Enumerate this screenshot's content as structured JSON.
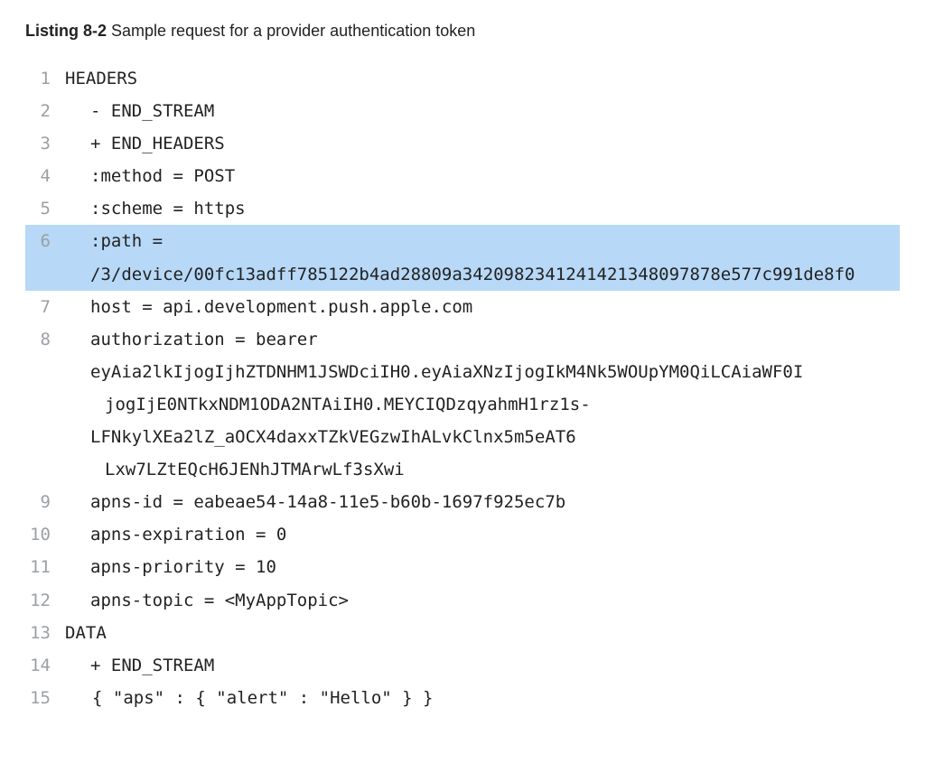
{
  "caption": {
    "label": "Listing 8-2",
    "title": "Sample request for a provider authentication token"
  },
  "lines": {
    "l1": {
      "num": "1",
      "text": "HEADERS"
    },
    "l2": {
      "num": "2",
      "text": "- END_STREAM"
    },
    "l3": {
      "num": "3",
      "text": "+ END_HEADERS"
    },
    "l4": {
      "num": "4",
      "text": ":method = POST"
    },
    "l5": {
      "num": "5",
      "text": ":scheme = https"
    },
    "l6": {
      "num": "6",
      "text": ":path ="
    },
    "l6b": {
      "num": "",
      "text": "/3/device/00fc13adff785122b4ad28809a34209823412414213480978​78e577c991de8f0"
    },
    "l7": {
      "num": "7",
      "text": "host = api.development.push.apple.com"
    },
    "l8": {
      "num": "8",
      "text": "authorization = bearer"
    },
    "l8b": {
      "num": "",
      "text": "eyAia2lkIjogIjhZTDNHM1JSWDciIH0.eyAiaXNzIjogIkM4Nk5WOUpYM0QiLCAiaWF0I"
    },
    "l8c": {
      "num": "",
      "text": "jogIjE0NTkxNDM1ODA2NTAiIH0.MEYCIQDzqyahmH1rz1s-"
    },
    "l8d": {
      "num": "",
      "text": "LFNkylXEa2lZ_aOCX4daxxTZkVEGzwIhALvkClnx5m5eAT6"
    },
    "l8e": {
      "num": "",
      "text": "Lxw7LZtEQcH6JENhJTMArwLf3sXwi"
    },
    "l9": {
      "num": "9",
      "text": "apns-id = eabeae54-14a8-11e5-b60b-1697f925ec7b"
    },
    "l10": {
      "num": "10",
      "text": "apns-expiration = 0"
    },
    "l11": {
      "num": "11",
      "text": "apns-priority = 10"
    },
    "l12": {
      "num": "12",
      "text": "apns-topic = <MyAppTopic>"
    },
    "l13": {
      "num": "13",
      "text": "DATA"
    },
    "l14": {
      "num": "14",
      "text": "+ END_STREAM"
    },
    "l15": {
      "num": "15",
      "text": "{ \"aps\" : { \"alert\" : \"Hello\" } }"
    }
  }
}
